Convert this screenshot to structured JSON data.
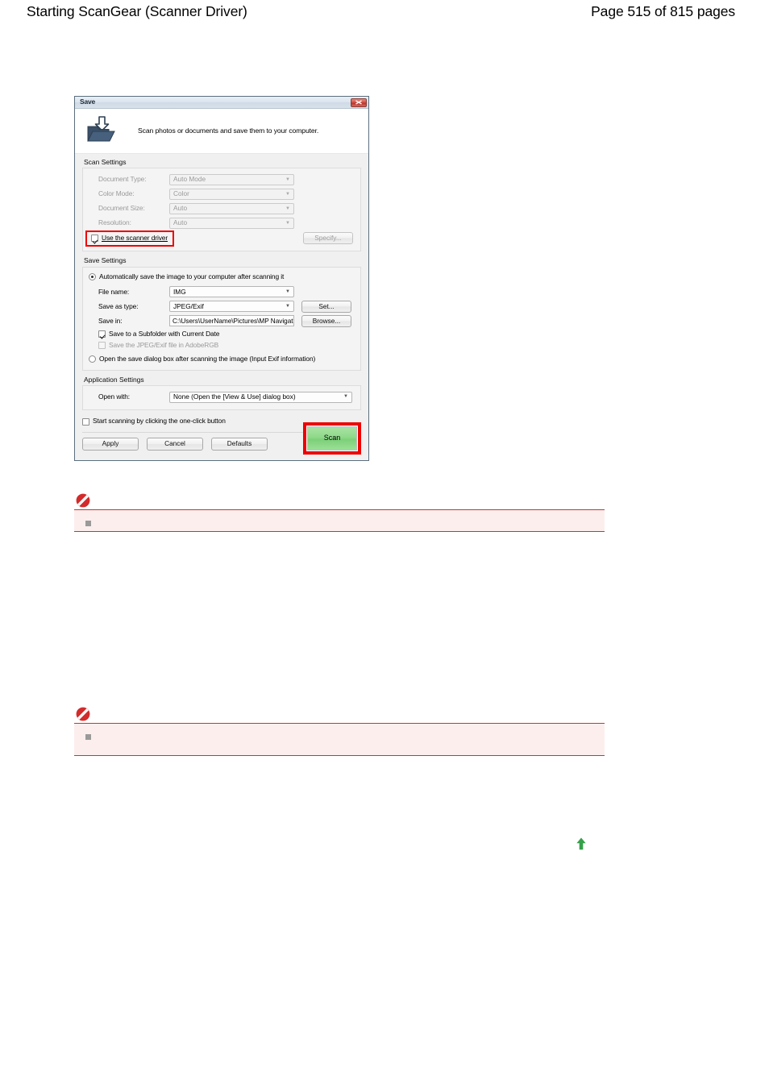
{
  "page_header": {
    "title": "Starting ScanGear (Scanner Driver)",
    "page_number": "Page 515 of 815 pages"
  },
  "dialog": {
    "title": "Save",
    "close_button_label": "Close",
    "banner_text": "Scan photos or documents and save them to your computer.",
    "banner_icon": "save-to-folder-icon",
    "scan_settings": {
      "group_title": "Scan Settings",
      "fields": [
        {
          "label": "Document Type:",
          "value": "Auto Mode",
          "disabled": true
        },
        {
          "label": "Color Mode:",
          "value": "Color",
          "disabled": true
        },
        {
          "label": "Document Size:",
          "value": "Auto",
          "disabled": true
        },
        {
          "label": "Resolution:",
          "value": "Auto",
          "disabled": true
        }
      ],
      "use_scanner_driver_label": "Use the scanner driver",
      "use_scanner_driver_checked": true,
      "specify_button": "Specify..."
    },
    "save_settings": {
      "group_title": "Save Settings",
      "auto_save_radio_label": "Automatically save the image to your computer after scanning it",
      "auto_save_selected": true,
      "file_name_label": "File name:",
      "file_name_value": "IMG",
      "save_as_type_label": "Save as  type:",
      "save_as_type_value": "JPEG/Exif",
      "set_button": "Set...",
      "save_in_label": "Save in:",
      "save_in_value": "C:\\Users\\UserName\\Pictures\\MP Navigat",
      "browse_button": "Browse...",
      "subfolder_label": "Save to a Subfolder with Current Date",
      "subfolder_checked": true,
      "adobergb_label": "Save the JPEG/Exif file in AdobeRGB",
      "adobergb_checked": false,
      "adobergb_disabled": true,
      "open_dialog_radio_label": "Open the save dialog box after scanning the image (Input Exif information)",
      "open_dialog_selected": false
    },
    "application_settings": {
      "group_title": "Application Settings",
      "open_with_label": "Open with:",
      "open_with_value": "None (Open the [View & Use] dialog box)"
    },
    "one_click_label": "Start scanning by clicking the one-click button",
    "one_click_checked": false,
    "buttons": {
      "apply": "Apply",
      "cancel": "Cancel",
      "defaults": "Defaults",
      "scan": "Scan"
    }
  },
  "highlights": {
    "color": "#ee0000",
    "items": [
      "use-the-scanner-driver-checkbox",
      "scan-button"
    ]
  },
  "notes": [
    {
      "icon": "caution-icon",
      "bullet": "■",
      "text": ""
    },
    {
      "icon": "caution-icon",
      "bullet": "■",
      "text": ""
    }
  ],
  "page_top": {
    "icon": "page-top-arrow-icon",
    "color": "#2f9e44"
  }
}
